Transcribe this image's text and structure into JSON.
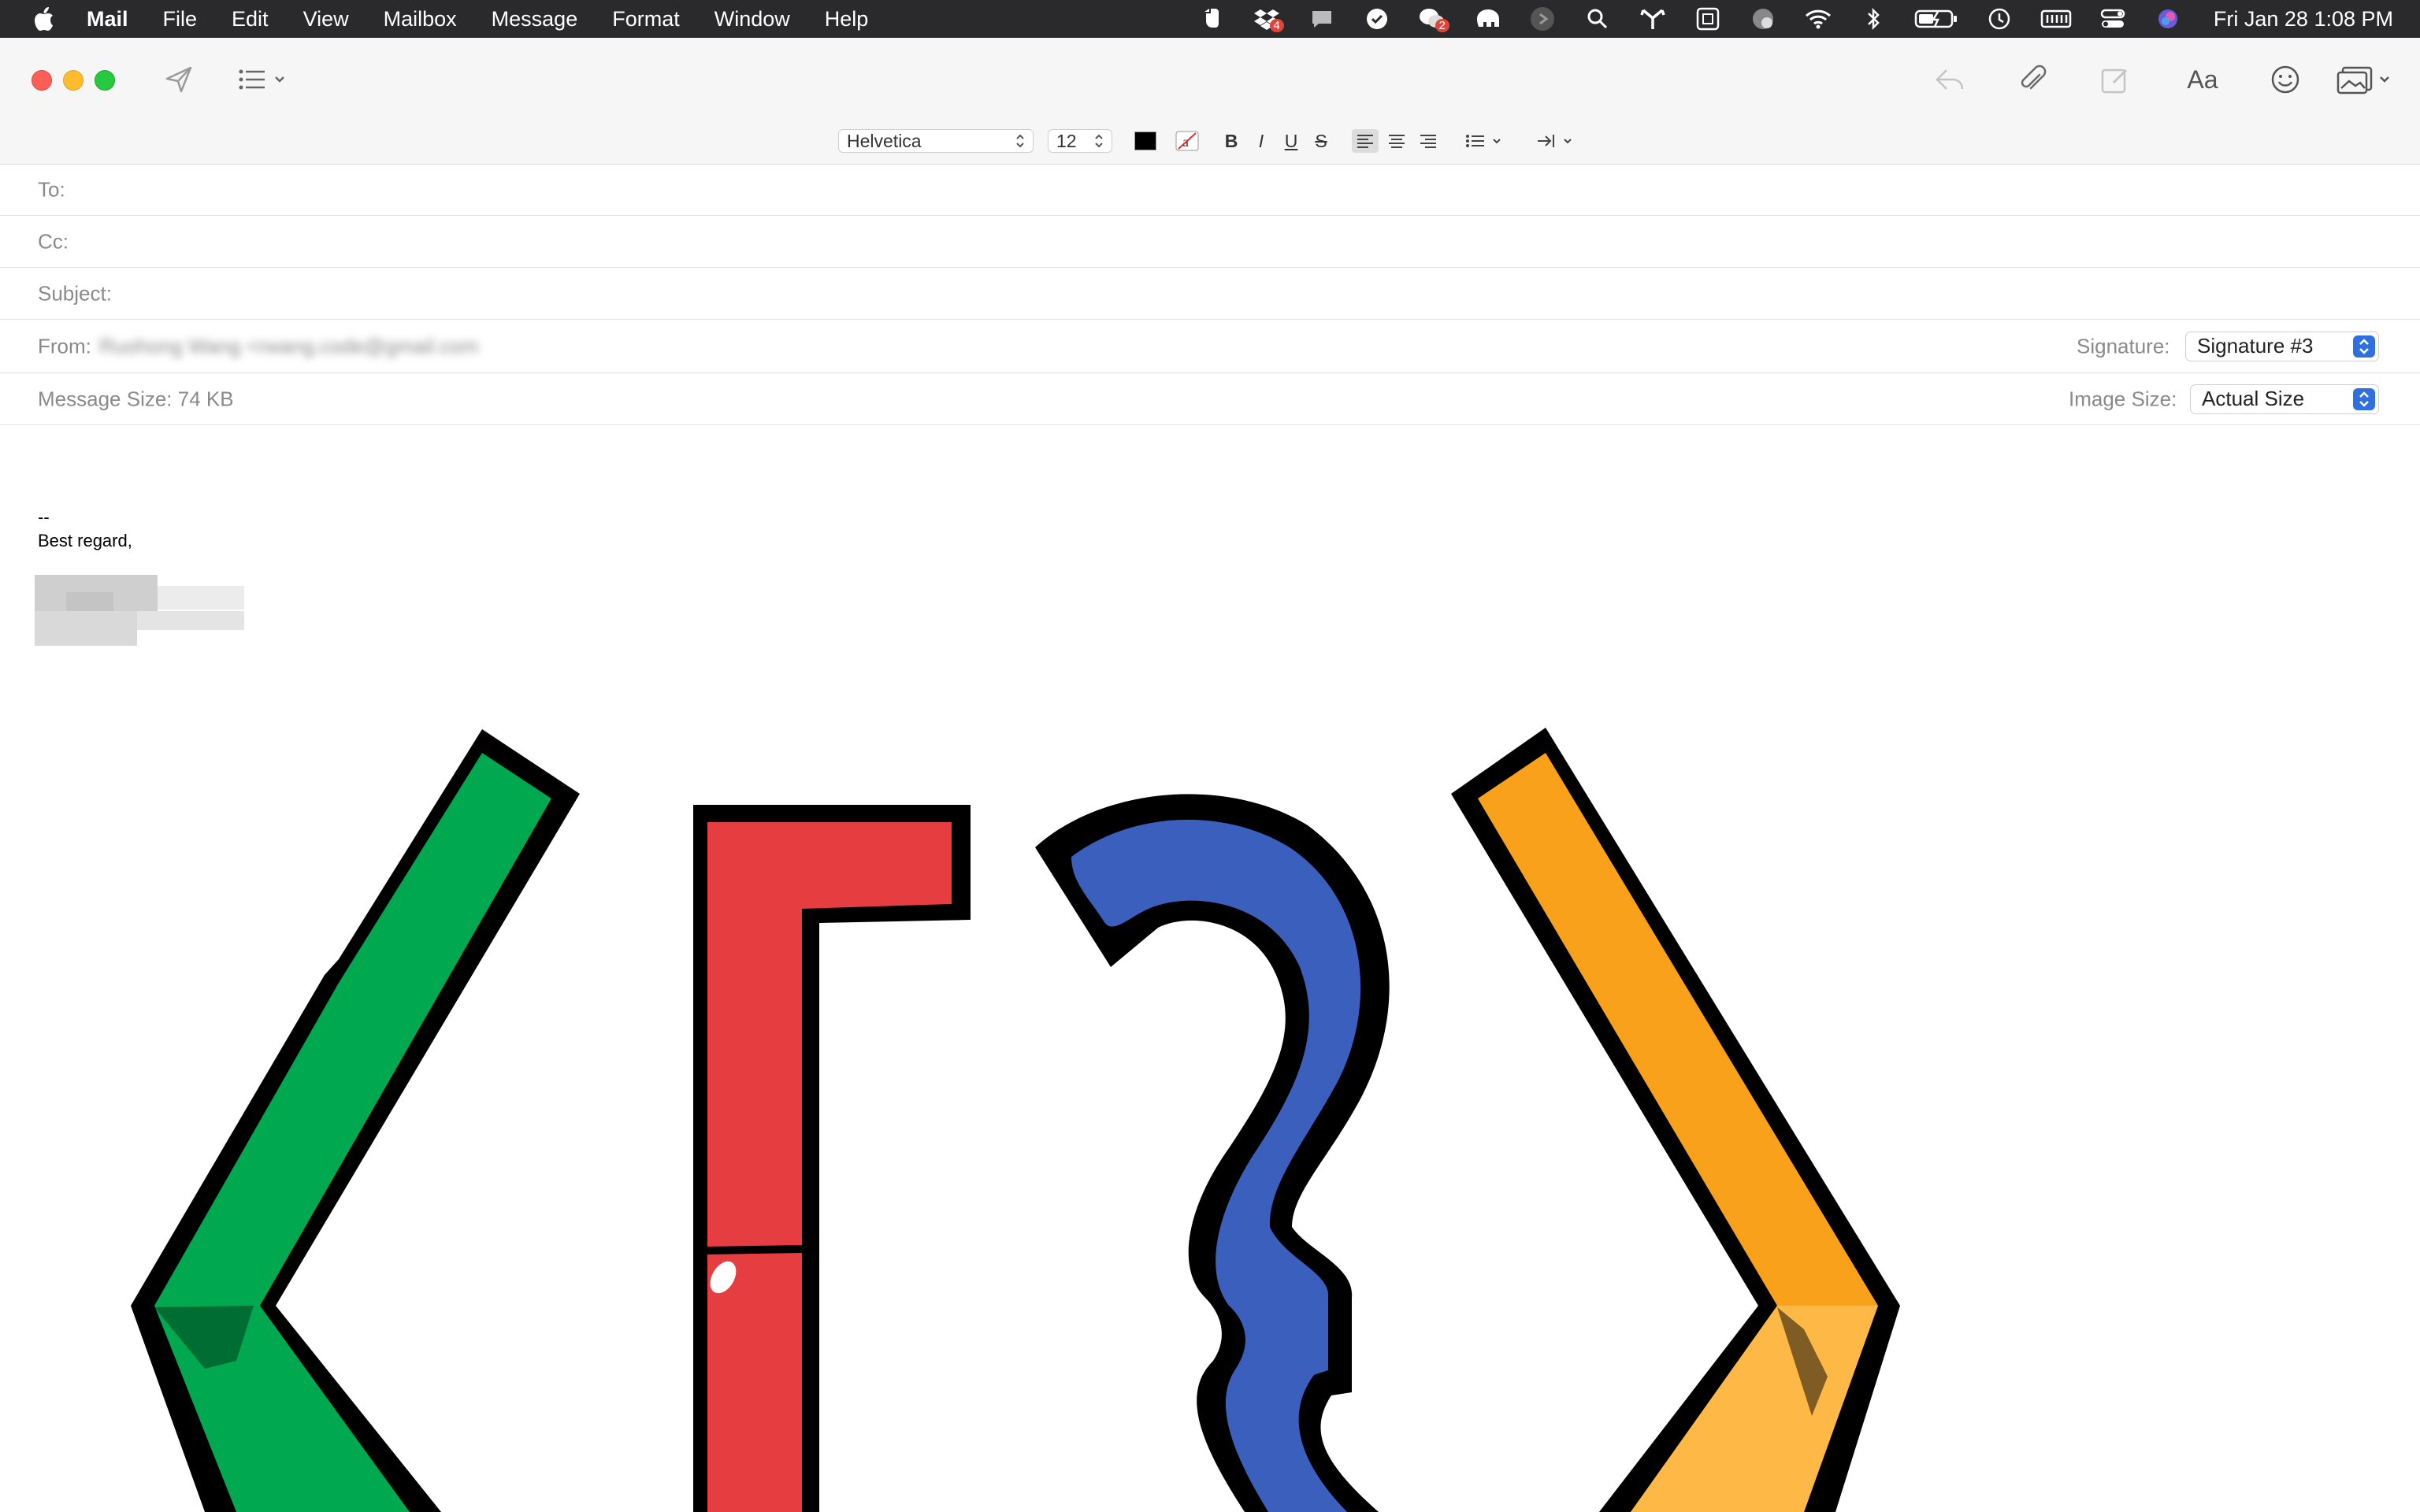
{
  "menubar": {
    "items": [
      "Mail",
      "File",
      "Edit",
      "View",
      "Mailbox",
      "Message",
      "Format",
      "Window",
      "Help"
    ],
    "status_icons": [
      "evernote-icon",
      "dropbox-icon",
      "chat-icon",
      "task-icon",
      "wechat-icon",
      "elephant-icon",
      "play-icon",
      "spotlight-icon",
      "network-icon",
      "keyboard-icon",
      "globe-icon",
      "wifi-icon",
      "bluetooth-icon",
      "battery-icon",
      "time-machine-icon",
      "memory-icon",
      "control-center-icon",
      "siri-icon"
    ],
    "badge_dropbox": "4",
    "badge_wechat": "2",
    "clock": "Fri Jan 28  1:08 PM"
  },
  "format_bar": {
    "font": "Helvetica",
    "size": "12",
    "bold": "B",
    "italic": "I",
    "underline": "U",
    "strike": "S",
    "color_swatch": "#000000"
  },
  "fields": {
    "to_label": "To:",
    "cc_label": "Cc:",
    "subject_label": "Subject:",
    "from_label": "From:",
    "from_value": "Ruohong Wang <rwang.code@gmail.com",
    "signature_label": "Signature:",
    "signature_value": "Signature #3",
    "message_size": "Message Size: 74 KB",
    "image_size_label": "Image Size:",
    "image_size_value": "Actual Size"
  },
  "body": {
    "dashes": "--",
    "closing": "Best regard,"
  },
  "colors": {
    "green": "#00a84f",
    "red": "#e53d40",
    "blue": "#3b5fbd",
    "orange": "#f9a11b",
    "light_orange": "#fdb846",
    "accent": "#2f6fe0"
  }
}
